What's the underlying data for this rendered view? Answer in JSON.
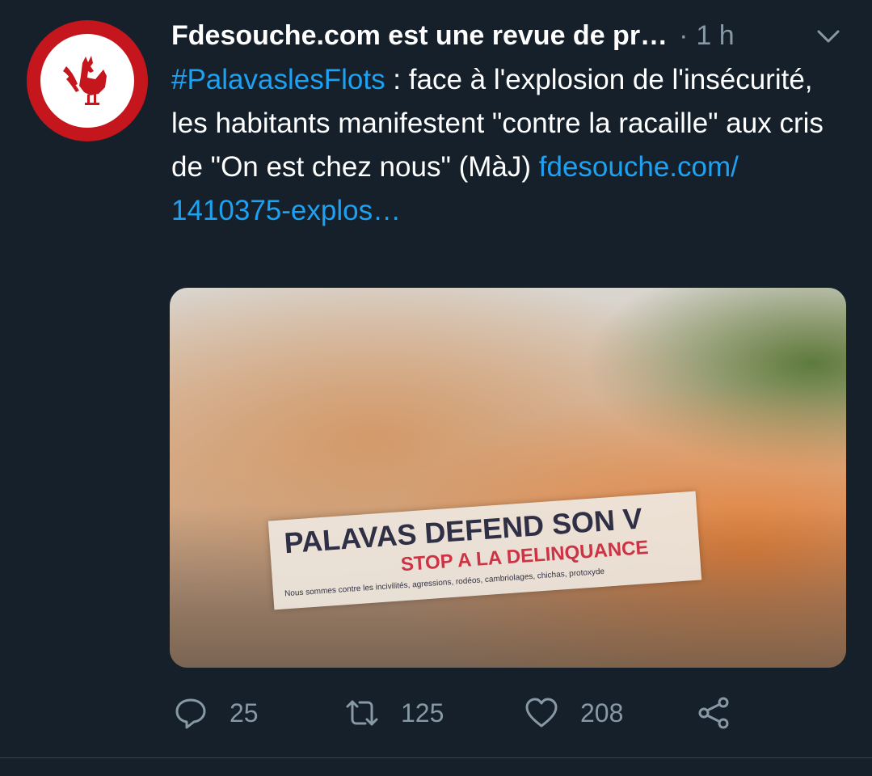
{
  "tweet": {
    "author_name": "Fdesouche.com est une revue de pr…",
    "meta_separator": "·",
    "time": "1 h",
    "hashtag": "#PalavaslesFlots",
    "text": " : face à l'explosion de l'insécurité, les habitants manifestent \"contre la racaille\" aux cris de \"On est chez nous\" (MàJ) ",
    "link_text": "fdesouche.com/ 1410375-explos…",
    "media": {
      "banner_line1": "PALAVAS DEFEND SON V",
      "banner_line2": "STOP A LA DELINQUANCE",
      "banner_line3": "Nous sommes contre les incivilités, agressions, rodéos, cambriolages, chichas, protoxyde"
    }
  },
  "actions": {
    "reply_count": "25",
    "retweet_count": "125",
    "like_count": "208"
  },
  "colors": {
    "background": "#15202b",
    "link": "#1da1f2",
    "muted": "#8899a6",
    "avatar_red": "#c4161c"
  },
  "icons": [
    "rooster-logo",
    "chevron-down-icon",
    "reply-icon",
    "retweet-icon",
    "like-icon",
    "share-icon"
  ]
}
